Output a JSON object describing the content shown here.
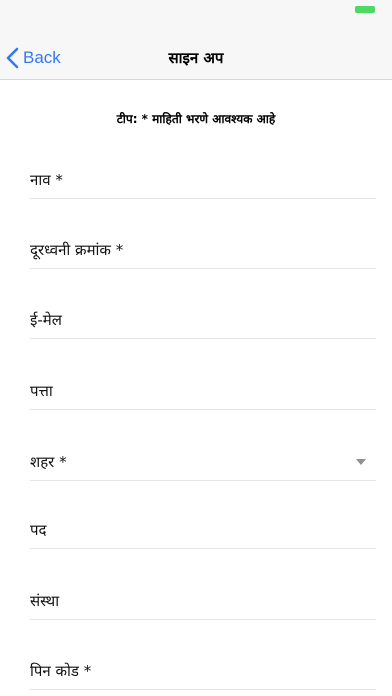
{
  "colors": {
    "accent": "#3478f6",
    "battery": "#4cd964",
    "nav_background": "#f7f7f7",
    "divider": "#e6e6e6",
    "chevron": "#8e8e93"
  },
  "nav": {
    "back_label": "Back",
    "back_icon": "chevron-left-icon",
    "title": "साइन अप"
  },
  "form": {
    "hint": "टीप: * माहिती भरणे आवश्यक आहे",
    "fields": [
      {
        "label": "नाव *",
        "required": true
      },
      {
        "label": "दूरध्वनी क्रमांक *",
        "required": true
      },
      {
        "label": "ई-मेल",
        "required": false
      },
      {
        "label": "पत्ता",
        "required": false
      },
      {
        "label": "शहर *",
        "required": true,
        "type": "dropdown",
        "icon": "dropdown-triangle-icon"
      },
      {
        "label": "पद",
        "required": false
      },
      {
        "label": "संस्था",
        "required": false
      },
      {
        "label": "पिन कोड *",
        "required": true
      }
    ]
  }
}
